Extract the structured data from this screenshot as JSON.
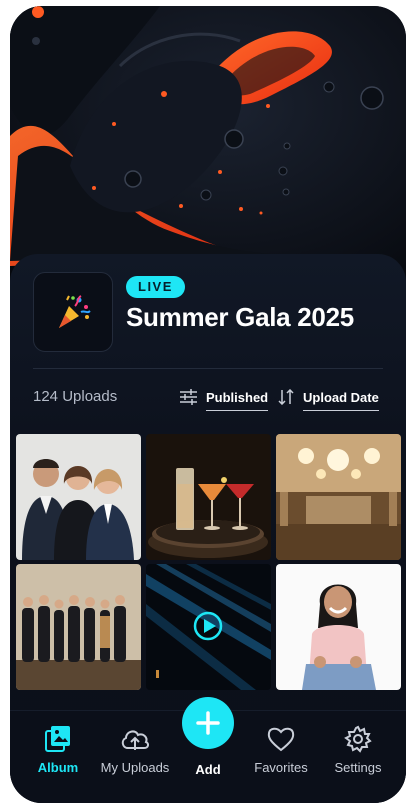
{
  "event": {
    "status_badge": "LIVE",
    "title": "Summer Gala 2025",
    "icon": "party-popper-icon"
  },
  "toolbar": {
    "uploads_count": "124 Uploads",
    "filter_label": "Published",
    "sort_label": "Upload Date"
  },
  "gallery": {
    "items": [
      {
        "kind": "photo",
        "subject": "group of three people in business attire"
      },
      {
        "kind": "photo",
        "subject": "cocktails on a tray"
      },
      {
        "kind": "photo",
        "subject": "ballroom with chandeliers"
      },
      {
        "kind": "photo",
        "subject": "group photo of guests"
      },
      {
        "kind": "video",
        "subject": "stage with blue light beams"
      },
      {
        "kind": "photo",
        "subject": "smiling woman in pink shirt"
      }
    ]
  },
  "nav": {
    "items": [
      {
        "label": "Album",
        "icon": "album-icon",
        "active": true
      },
      {
        "label": "My Uploads",
        "icon": "cloud-upload-icon",
        "active": false
      },
      {
        "label": "Add",
        "icon": "plus-icon",
        "active": false
      },
      {
        "label": "Favorites",
        "icon": "heart-icon",
        "active": false
      },
      {
        "label": "Settings",
        "icon": "gear-icon",
        "active": false
      }
    ]
  },
  "colors": {
    "accent": "#1ee6f5",
    "background": "#0b0f19",
    "hero_orange": "#ff4a1c"
  }
}
